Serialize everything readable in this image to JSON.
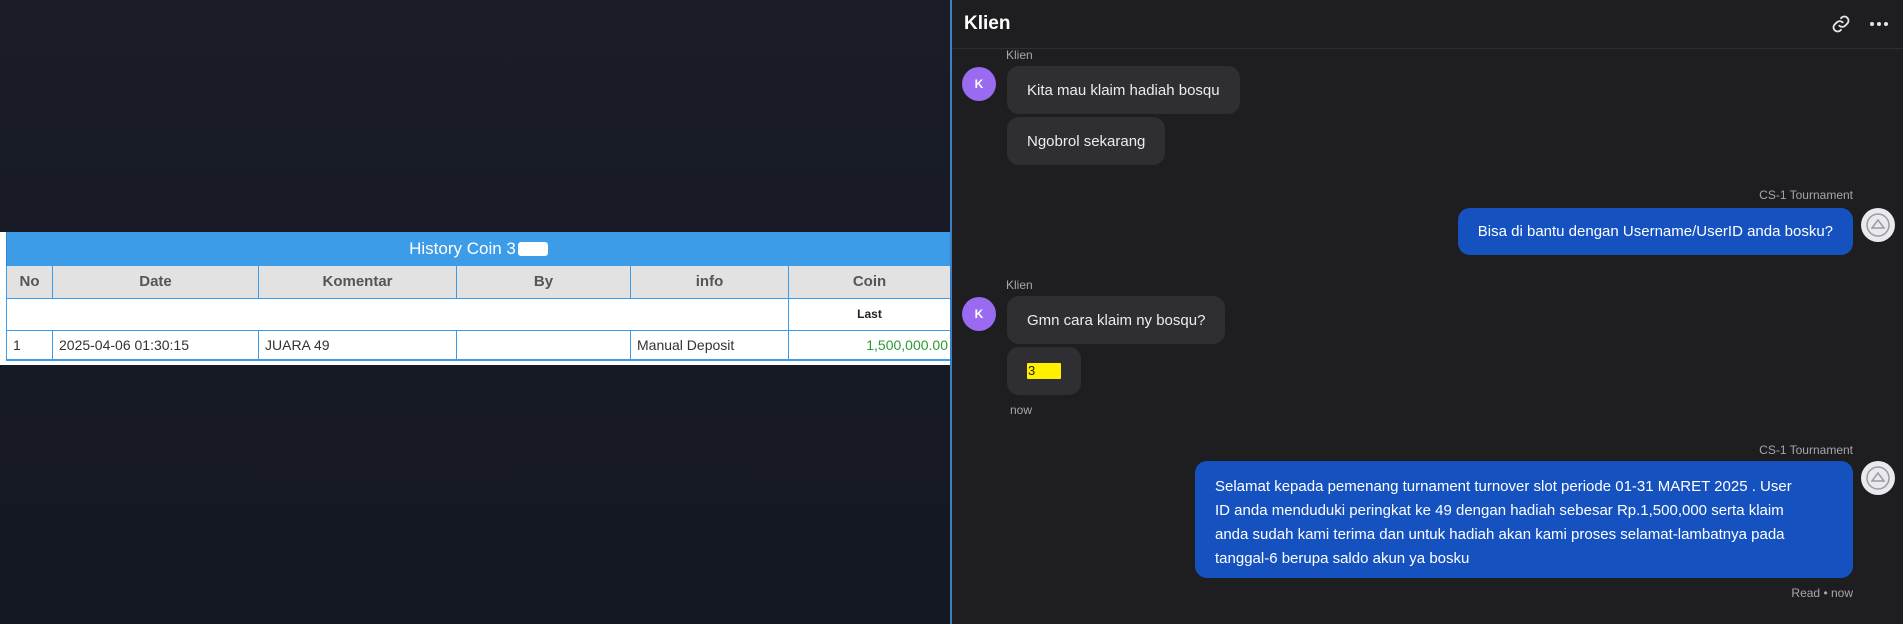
{
  "history": {
    "title": "History Coin 3",
    "columns": [
      "No",
      "Date",
      "Komentar",
      "By",
      "info",
      "Coin"
    ],
    "subhead_coin": "Last",
    "rows": [
      {
        "no": "1",
        "date": "2025-04-06 01:30:15",
        "komentar": "JUARA 49",
        "by": "",
        "info": "Manual Deposit",
        "coin": "1,500,000.00"
      }
    ]
  },
  "chat": {
    "title": "Klien",
    "icons": [
      "link-icon",
      "more-icon"
    ],
    "messages": [
      {
        "sender": "Klien",
        "avatar": "K",
        "bubbles": [
          "Kita mau klaim hadiah bosqu",
          "Ngobrol sekarang"
        ]
      },
      {
        "sender": "CS-1 Tournament",
        "text": "Bisa di bantu dengan Username/UserID anda bosku?"
      },
      {
        "sender": "Klien",
        "avatar": "K",
        "bubbles": [
          "Gmn cara klaim ny bosqu?",
          "3"
        ],
        "time": "now"
      },
      {
        "sender": "CS-1 Tournament",
        "lines": [
          "Selamat kepada pemenang turnament turnover slot periode 01-31 MARET 2025 . User",
          "ID anda menduduki peringkat ke 49 dengan hadiah sebesar Rp.1,500,000 serta klaim",
          "anda sudah kami terima dan untuk hadiah akan kami proses selamat-lambatnya pada",
          "tanggal-6 berupa saldo akun ya bosku"
        ],
        "status": "Read • now"
      }
    ]
  },
  "colors": {
    "accent": "#3d9ce8",
    "outgoing": "#1552c0",
    "avatar": "#9a6bf0",
    "coin": "#2e9a2e"
  }
}
